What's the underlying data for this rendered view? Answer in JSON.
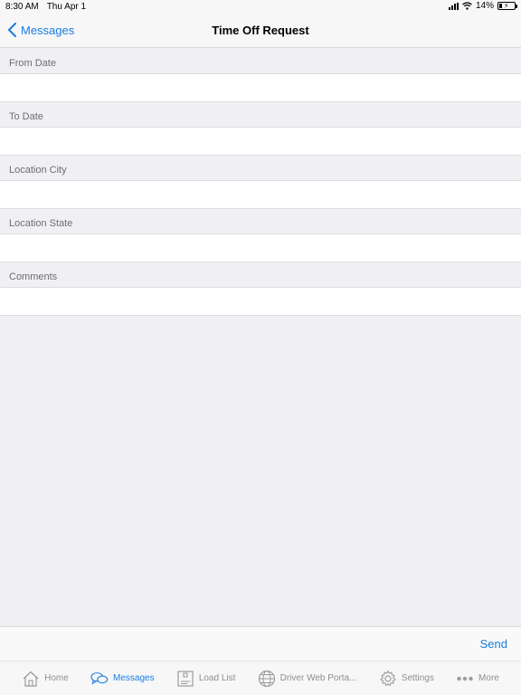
{
  "status_bar": {
    "time": "8:30 AM",
    "date": "Thu Apr 1",
    "battery": "14%"
  },
  "nav": {
    "back_label": "Messages",
    "title": "Time Off Request"
  },
  "form": {
    "fields": [
      {
        "label": "From Date",
        "value": ""
      },
      {
        "label": "To Date",
        "value": ""
      },
      {
        "label": "Location City",
        "value": ""
      },
      {
        "label": "Location State",
        "value": ""
      },
      {
        "label": "Comments",
        "value": ""
      }
    ]
  },
  "toolbar": {
    "send_label": "Send"
  },
  "tabs": [
    {
      "label": "Home",
      "icon": "home-icon",
      "active": false
    },
    {
      "label": "Messages",
      "icon": "chat-bubbles-icon",
      "active": true
    },
    {
      "label": "Load List",
      "icon": "load-list-icon",
      "active": false
    },
    {
      "label": "Driver Web Porta...",
      "icon": "globe-icon",
      "active": false
    },
    {
      "label": "Settings",
      "icon": "gear-icon",
      "active": false
    },
    {
      "label": "More",
      "icon": "more-dots-icon",
      "active": false
    }
  ],
  "colors": {
    "accent": "#1a7de0",
    "inactive": "#8e8e93",
    "background": "#efeff4"
  }
}
